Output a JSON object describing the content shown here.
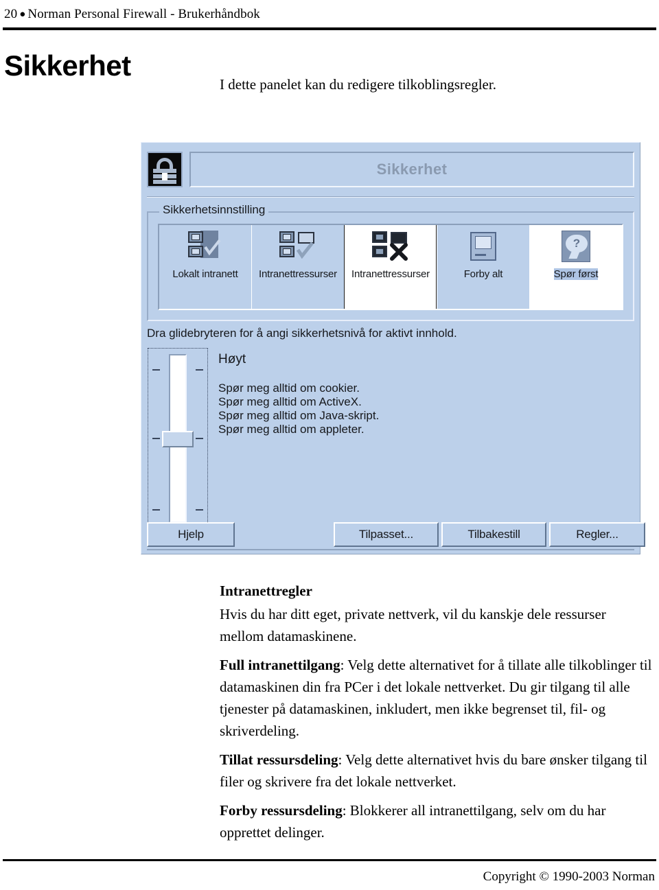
{
  "page": {
    "number": "20",
    "bullet": "●",
    "running_head": "Norman Personal Firewall - Brukerhåndbok",
    "chapter_title": "Sikkerhet",
    "intro": "I dette panelet kan du redigere tilkoblingsregler."
  },
  "screenshot": {
    "window_title": "Sikkerhet",
    "lock_icon": "padlock-icon",
    "groupbox_label": "Sikkerhetsinnstilling",
    "zones": [
      {
        "label": "Lokalt intranett",
        "icon": "computer-check-icon",
        "selected": false
      },
      {
        "label": "Intranettressurser",
        "icon": "computer-folder-down-icon",
        "selected": false
      },
      {
        "label": "Intranettressurser",
        "icon": "computer-folder-x-icon",
        "selected": true
      },
      {
        "label": "Forby alt",
        "icon": "monitor-icon",
        "selected": false
      },
      {
        "label": "Spør først",
        "icon": "question-bubble-icon",
        "selected": true
      }
    ],
    "slider_help": "Dra glidebryteren for å angi sikkerhetsnivå for aktivt innhold.",
    "level_label": "Høyt",
    "level_items": [
      "Spør meg alltid om cookier.",
      "Spør meg alltid om ActiveX.",
      "Spør meg alltid om Java-skript.",
      "Spør meg alltid om appleter."
    ],
    "buttons": {
      "help": "Hjelp",
      "custom": "Tilpasset...",
      "reset": "Tilbakestill",
      "rules": "Regler..."
    }
  },
  "body": {
    "heading": "Intranettregler",
    "p1": "Hvis du har ditt eget, private nettverk, vil du kanskje dele ressurser mellom datamaskinene.",
    "p2_bold": "Full intranettilgang",
    "p2_rest": ": Velg dette alternativet for å tillate alle tilkoblinger til datamaskinen din fra PCer i det lokale nettverket. Du gir tilgang til alle tjenester på datamaskinen, inkludert, men ikke begrenset til, fil- og skriverdeling.",
    "p3_bold": "Tillat ressursdeling",
    "p3_rest": ": Velg dette alternativet hvis du bare ønsker tilgang til filer og skrivere fra det lokale nettverket.",
    "p4_bold": "Forby ressursdeling",
    "p4_rest": ": Blokkerer all intranettilgang, selv om du har opprettet delinger."
  },
  "footer": {
    "copyright": "Copyright © 1990-2003 Norman"
  }
}
